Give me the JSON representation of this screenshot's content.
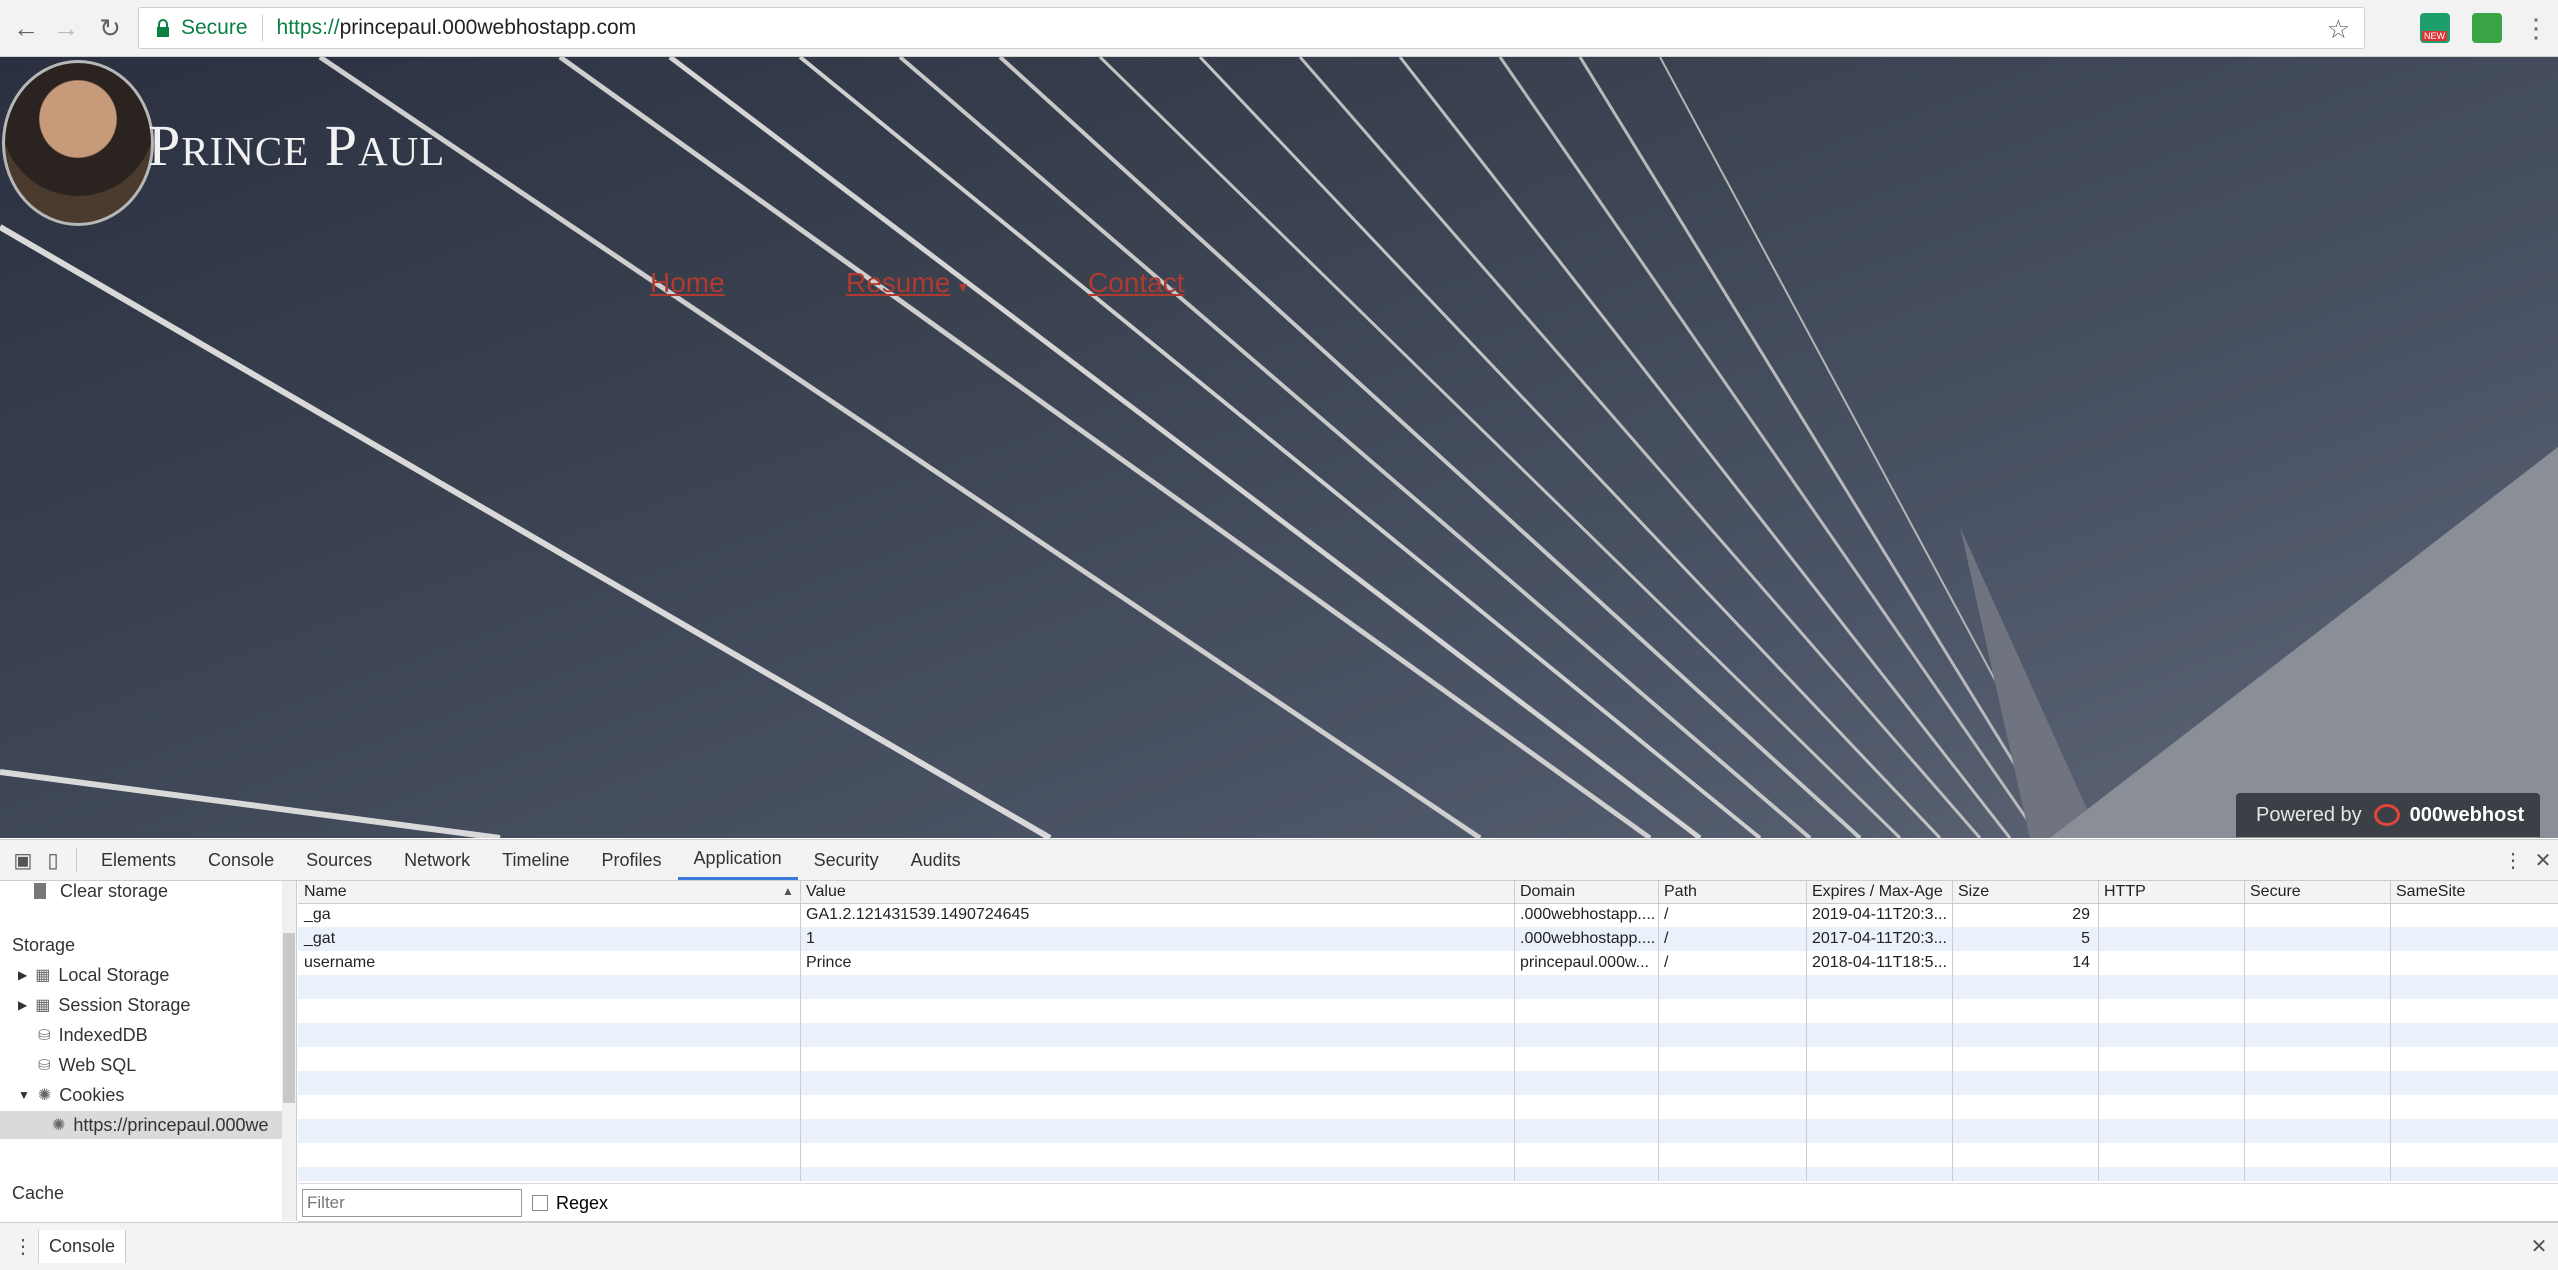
{
  "browser": {
    "secure_label": "Secure",
    "url_scheme": "https://",
    "url_host": "princepaul.000webhostapp.com",
    "extension_badge": "NEW"
  },
  "site": {
    "title": "Prince Paul",
    "menu": [
      "Home",
      "Resume",
      "Contact"
    ],
    "powered_by": "Powered by",
    "brand": "000webhost"
  },
  "devtools": {
    "tabs": [
      "Elements",
      "Console",
      "Sources",
      "Network",
      "Timeline",
      "Profiles",
      "Application",
      "Security",
      "Audits"
    ],
    "active_tab": "Application",
    "sidebar": {
      "clear_storage": "Clear storage",
      "storage_heading": "Storage",
      "local_storage": "Local Storage",
      "session_storage": "Session Storage",
      "indexeddb": "IndexedDB",
      "web_sql": "Web SQL",
      "cookies": "Cookies",
      "cookie_origin": "https://princepaul.000we",
      "cache_heading": "Cache"
    },
    "columns": [
      "Name",
      "Value",
      "Domain",
      "Path",
      "Expires / Max-Age",
      "Size",
      "HTTP",
      "Secure",
      "SameSite"
    ],
    "rows": [
      {
        "name": "_ga",
        "value": "GA1.2.121431539.1490724645",
        "domain": ".000webhostapp....",
        "path": "/",
        "expires": "2019-04-11T20:3...",
        "size": "29"
      },
      {
        "name": "_gat",
        "value": "1",
        "domain": ".000webhostapp....",
        "path": "/",
        "expires": "2017-04-11T20:3...",
        "size": "5"
      },
      {
        "name": "username",
        "value": "Prince",
        "domain": "princepaul.000w...",
        "path": "/",
        "expires": "2018-04-11T18:5...",
        "size": "14"
      }
    ],
    "filter_placeholder": "Filter",
    "regex_label": "Regex",
    "drawer_tab": "Console"
  }
}
